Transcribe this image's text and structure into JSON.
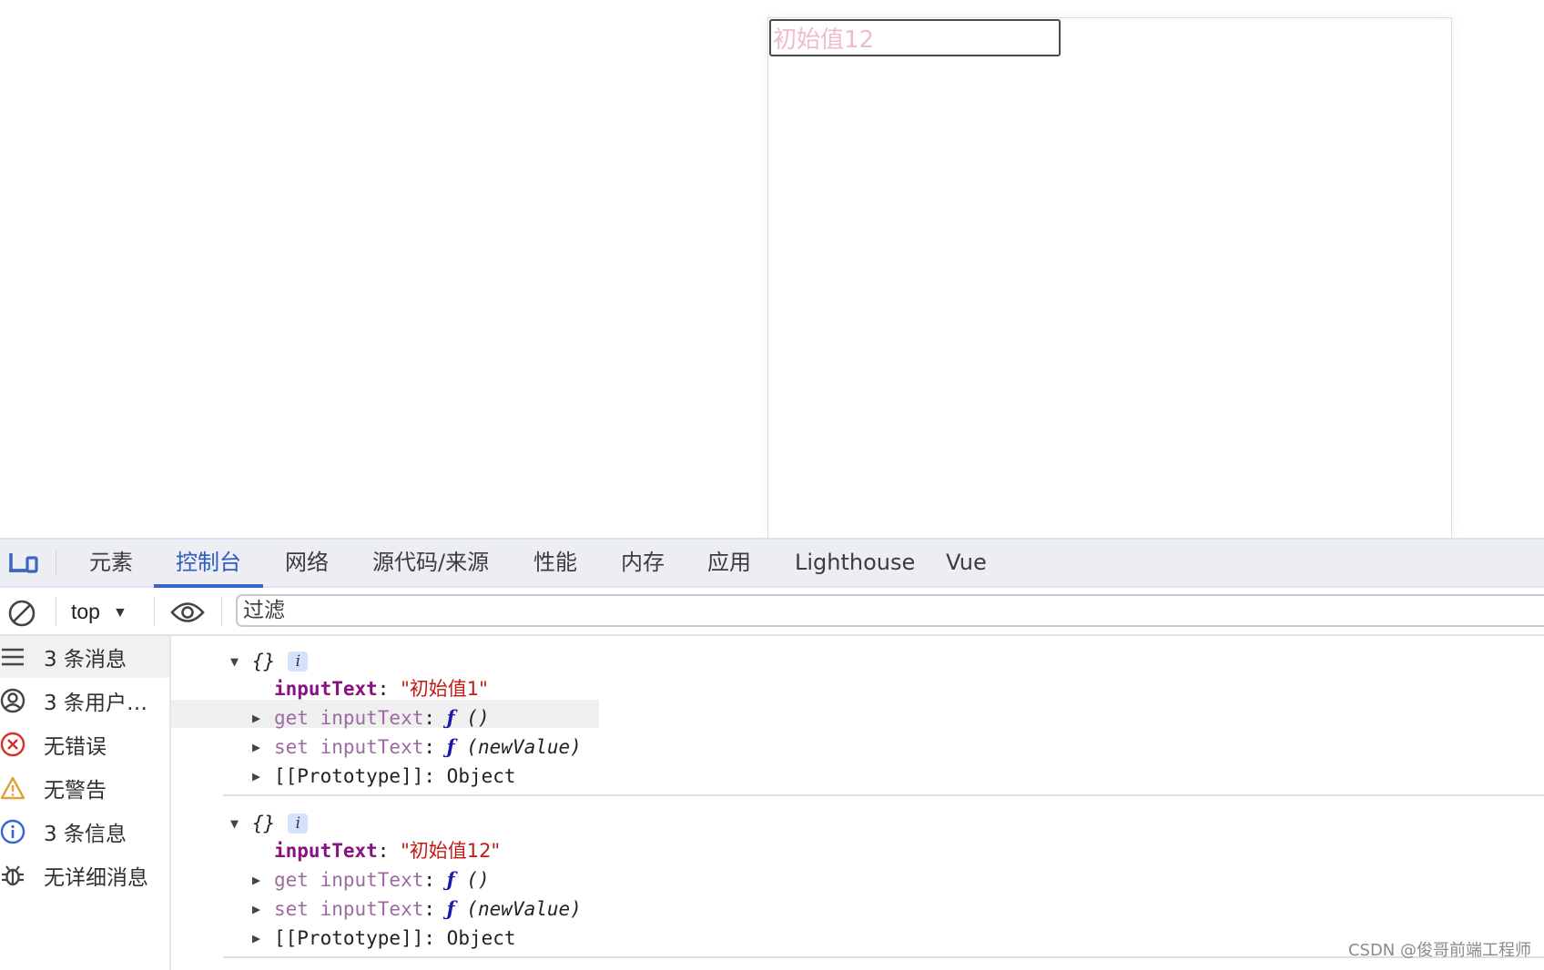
{
  "page": {
    "input_value": "初始值12"
  },
  "devtools": {
    "tabs": [
      {
        "label": "元素",
        "active": false
      },
      {
        "label": "控制台",
        "active": true
      },
      {
        "label": "网络",
        "active": false
      },
      {
        "label": "源代码/来源",
        "active": false
      },
      {
        "label": "性能",
        "active": false
      },
      {
        "label": "内存",
        "active": false
      },
      {
        "label": "应用",
        "active": false
      },
      {
        "label": "Lighthouse",
        "active": false
      },
      {
        "label": "Vue",
        "active": false
      }
    ],
    "toolbar": {
      "context": "top",
      "filter_placeholder": "过滤"
    },
    "sidebar": {
      "items": [
        {
          "label": "3 条消息",
          "icon": "list-icon",
          "selected": true
        },
        {
          "label": "3 条用户…",
          "icon": "user-icon",
          "selected": false
        },
        {
          "label": "无错误",
          "icon": "error-icon",
          "selected": false
        },
        {
          "label": "无警告",
          "icon": "warning-icon",
          "selected": false
        },
        {
          "label": "3 条信息",
          "icon": "info-icon",
          "selected": false
        },
        {
          "label": "无详细消息",
          "icon": "bug-icon",
          "selected": false
        }
      ]
    },
    "console": {
      "messages": [
        {
          "summary": "{}",
          "badge": "i",
          "key": "inputText",
          "value": "\"初始值1\"",
          "getter_label": "get inputText",
          "getter_fn": "ƒ",
          "getter_args": "()",
          "setter_label": "set inputText",
          "setter_fn": "ƒ",
          "setter_args": "(newValue)",
          "proto_label": "[[Prototype]]",
          "proto_value": "Object"
        },
        {
          "summary": "{}",
          "badge": "i",
          "key": "inputText",
          "value": "\"初始值12\"",
          "getter_label": "get inputText",
          "getter_fn": "ƒ",
          "getter_args": "()",
          "setter_label": "set inputText",
          "setter_fn": "ƒ",
          "setter_args": "(newValue)",
          "proto_label": "[[Prototype]]",
          "proto_value": "Object"
        }
      ]
    },
    "colors": {
      "accent": "#3a65c4",
      "error": "#d93025",
      "warning": "#e0a13a",
      "info": "#3367d6"
    }
  },
  "watermark": "CSDN @俊哥前端工程师"
}
